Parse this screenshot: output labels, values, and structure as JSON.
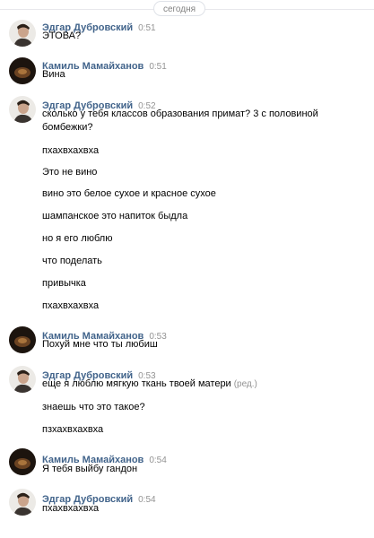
{
  "date_divider": "сегодня",
  "groups": [
    {
      "author": "Эдгар Дубровский",
      "time": "0:51",
      "avatar": "edgar",
      "messages": [
        {
          "text": "ЭТОВА?"
        }
      ]
    },
    {
      "author": "Камиль Мамайханов",
      "time": "0:51",
      "avatar": "kamil",
      "messages": [
        {
          "text": "Вина"
        }
      ]
    },
    {
      "author": "Эдгар Дубровский",
      "time": "0:52",
      "avatar": "edgar",
      "messages": [
        {
          "text": "сколько у тебя классов образования примат? 3 с половиной бомбежки?"
        },
        {
          "text": "пхахвхахвха"
        },
        {
          "text": "Это не вино"
        },
        {
          "text": "вино это белое сухое и красное сухое"
        },
        {
          "text": "шампанское это напиток быдла"
        },
        {
          "text": "но я его люблю"
        },
        {
          "text": "что поделать"
        },
        {
          "text": "привычка"
        },
        {
          "text": "пхахвхахвха"
        }
      ]
    },
    {
      "author": "Камиль Мамайханов",
      "time": "0:53",
      "avatar": "kamil",
      "messages": [
        {
          "text": "Похуй мне что ты любиш"
        }
      ]
    },
    {
      "author": "Эдгар Дубровский",
      "time": "0:53",
      "avatar": "edgar",
      "messages": [
        {
          "text": "еще я люблю мягкую ткань твоей матери",
          "edited": "(ред.)"
        },
        {
          "text": "знаешь что это такое?"
        },
        {
          "text": "пзхахвхахвха"
        }
      ]
    },
    {
      "author": "Камиль Мамайханов",
      "time": "0:54",
      "avatar": "kamil",
      "messages": [
        {
          "text": "Я тебя выйбу гандон"
        }
      ]
    },
    {
      "author": "Эдгар Дубровский",
      "time": "0:54",
      "avatar": "edgar",
      "messages": [
        {
          "text": "пхахвхахвха"
        }
      ]
    }
  ]
}
